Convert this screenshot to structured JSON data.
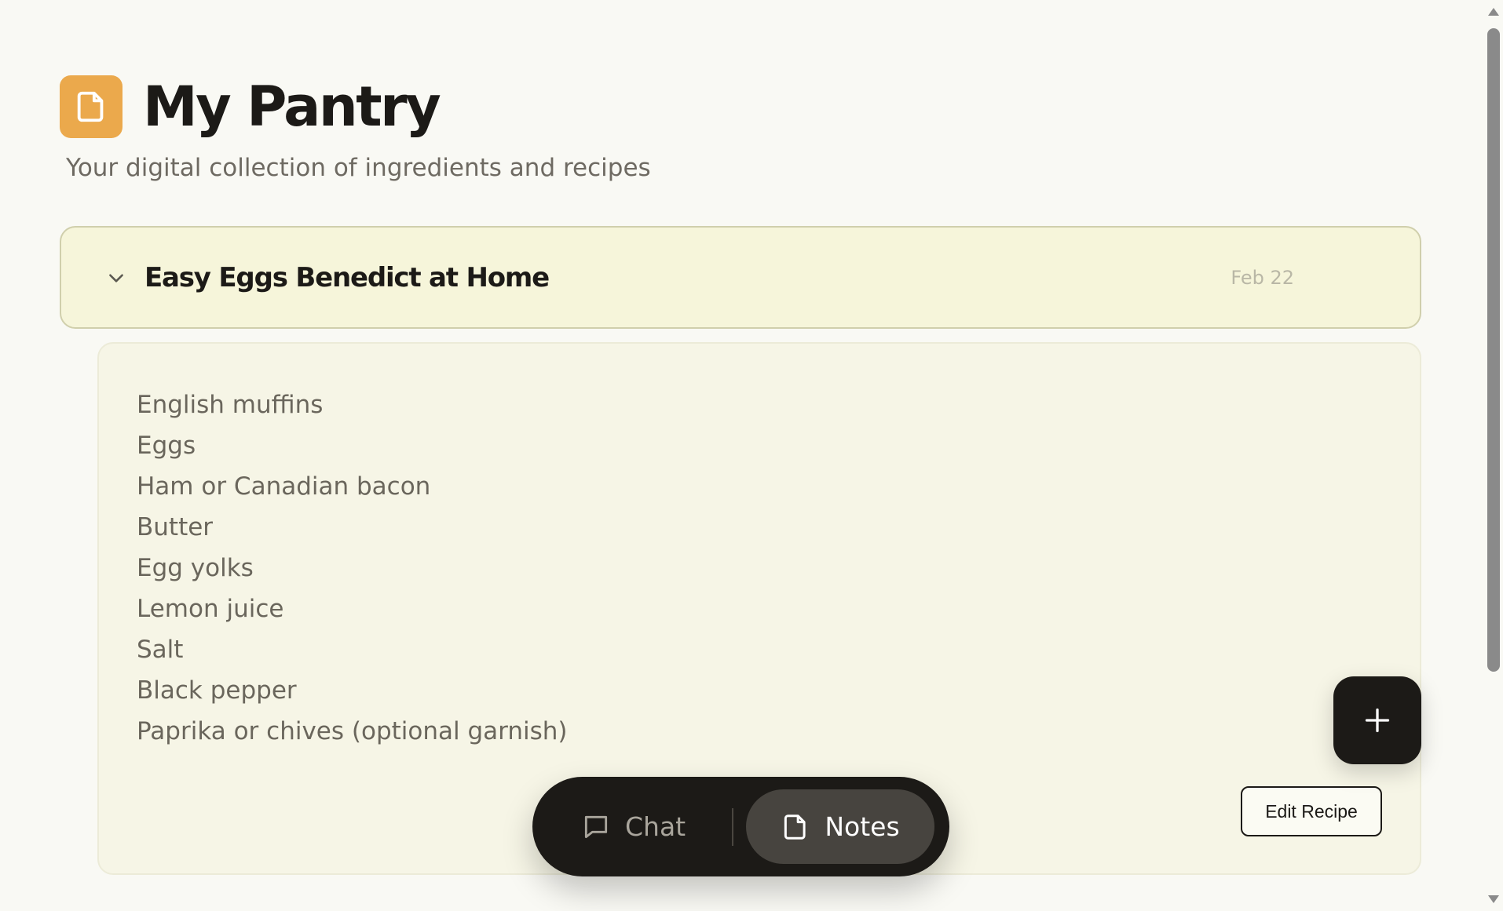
{
  "app": {
    "title": "My Pantry",
    "subtitle": "Your digital collection of ingredients and recipes",
    "icon": "note-icon",
    "accent_color": "#eba94c"
  },
  "recipe": {
    "title": "Easy Eggs Benedict at Home",
    "date": "Feb 22",
    "expanded": true,
    "ingredients": [
      "English muffins",
      "Eggs",
      "Ham or Canadian bacon",
      "Butter",
      "Egg yolks",
      "Lemon juice",
      "Salt",
      "Black pepper",
      "Paprika or chives (optional garnish)"
    ],
    "edit_label": "Edit Recipe"
  },
  "fab": {
    "icon": "plus-icon"
  },
  "nav": {
    "chat_label": "Chat",
    "notes_label": "Notes",
    "active": "Notes"
  }
}
